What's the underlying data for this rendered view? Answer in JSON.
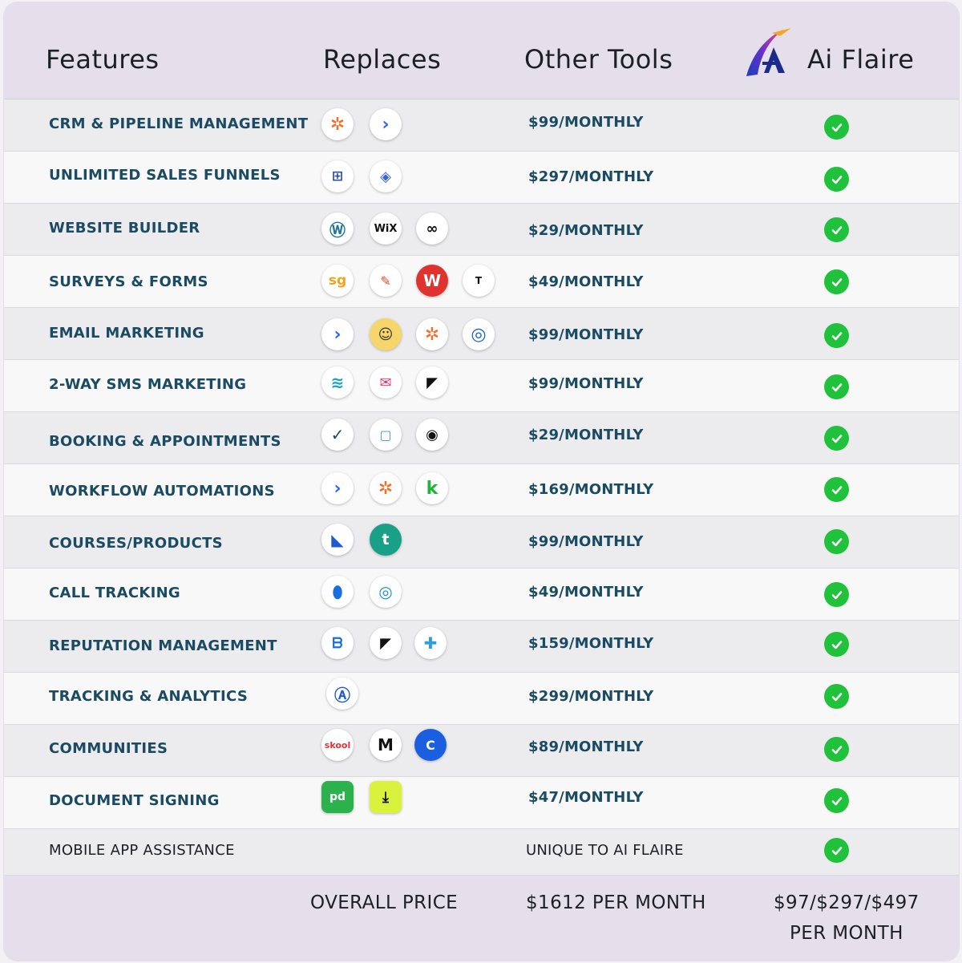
{
  "header": {
    "features": "Features",
    "replaces": "Replaces",
    "other_tools": "Other Tools",
    "brand": "Ai Flaire"
  },
  "rows": [
    {
      "feature": "CRM & PIPELINE MANAGEMENT",
      "price": "$99/MONTHLY",
      "icons": [
        "hubspot-icon",
        "activecampaign-icon"
      ]
    },
    {
      "feature": "UNLIMITED SALES FUNNELS",
      "price": "$297/MONTHLY",
      "icons": [
        "clickfunnels-icon",
        "leadpages-icon"
      ]
    },
    {
      "feature": "WEBSITE BUILDER",
      "price": "$29/MONTHLY",
      "icons": [
        "wordpress-icon",
        "wix-icon",
        "squarespace-icon"
      ]
    },
    {
      "feature": "SURVEYS & FORMS",
      "price": "$49/MONTHLY",
      "icons": [
        "surveygizmo-icon",
        "typeform-pen-icon",
        "wufoo-icon",
        "typeform-icon"
      ]
    },
    {
      "feature": "EMAIL MARKETING",
      "price": "$99/MONTHLY",
      "icons": [
        "activecampaign-icon",
        "mailchimp-icon",
        "hubspot-icon",
        "constant-contact-icon"
      ]
    },
    {
      "feature": "2-WAY SMS MARKETING",
      "price": "$99/MONTHLY",
      "icons": [
        "simpletexting-icon",
        "sms-envelope-icon",
        "podium-icon"
      ]
    },
    {
      "feature": "BOOKING & APPOINTMENTS",
      "price": "$29/MONTHLY",
      "icons": [
        "acuity-icon",
        "calendar-icon",
        "scheduling-icon"
      ]
    },
    {
      "feature": "WORKFLOW AUTOMATIONS",
      "price": "$169/MONTHLY",
      "icons": [
        "activecampaign-icon",
        "hubspot-icon",
        "keap-icon"
      ]
    },
    {
      "feature": "COURSES/PRODUCTS",
      "price": "$99/MONTHLY",
      "icons": [
        "kajabi-icon",
        "teachable-icon"
      ]
    },
    {
      "feature": "CALL TRACKING",
      "price": "$49/MONTHLY",
      "icons": [
        "callrail-icon",
        "calltracking-icon"
      ]
    },
    {
      "feature": "REPUTATION MANAGEMENT",
      "price": "$159/MONTHLY",
      "icons": [
        "birdeye-icon",
        "podium-icon",
        "reputation-icon"
      ]
    },
    {
      "feature": "TRACKING & ANALYTICS",
      "price": "$299/MONTHLY",
      "icons": [
        "analytics-icon"
      ]
    },
    {
      "feature": "COMMUNITIES",
      "price": "$89/MONTHLY",
      "icons": [
        "skool-icon",
        "mighty-networks-icon",
        "circle-icon"
      ]
    },
    {
      "feature": "DOCUMENT SIGNING",
      "price": "$47/MONTHLY",
      "icons": [
        "pandadoc-icon",
        "docusign-icon"
      ]
    },
    {
      "feature": "MOBILE APP ASSISTANCE",
      "price": "UNIQUE TO AI FLAIRE",
      "icons": []
    }
  ],
  "icon_text": {
    "wix": "WiX",
    "surveygizmo": "sg",
    "typeform": "T",
    "skool": "skool",
    "circle": "C",
    "teachable": "t"
  },
  "footer": {
    "overall_label": "OVERALL PRICE",
    "other_total": "$1612 PER MONTH",
    "flaire_price_line1": "$97/$297/$497",
    "flaire_price_line2": "PER MONTH"
  },
  "colors": {
    "feature_text": "#1b4b63",
    "check_green": "#1fc23a",
    "header_bg": "#e4dfea"
  }
}
